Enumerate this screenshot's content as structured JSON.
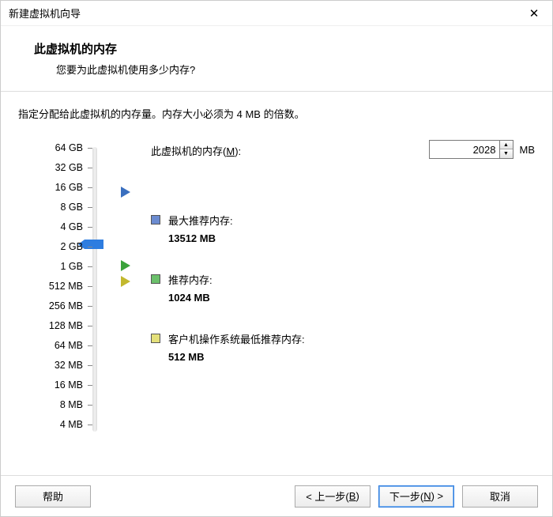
{
  "window": {
    "title": "新建虚拟机向导"
  },
  "header": {
    "heading": "此虚拟机的内存",
    "subtext": "您要为此虚拟机使用多少内存?"
  },
  "instruction": "指定分配给此虚拟机的内存量。内存大小必须为 4 MB 的倍数。",
  "memory": {
    "label_prefix": "此虚拟机的内存(",
    "label_accel": "M",
    "label_suffix": "):",
    "value": "2028",
    "unit": "MB",
    "ticks": [
      "64 GB",
      "32 GB",
      "16 GB",
      "8 GB",
      "4 GB",
      "2 GB",
      "1 GB",
      "512 MB",
      "256 MB",
      "128 MB",
      "64 MB",
      "32 MB",
      "16 MB",
      "8 MB",
      "4 MB"
    ]
  },
  "legends": {
    "max": {
      "label": "最大推荐内存:",
      "value": "13512 MB"
    },
    "rec": {
      "label": "推荐内存:",
      "value": "1024 MB"
    },
    "min": {
      "label": "客户机操作系统最低推荐内存:",
      "value": "512 MB"
    }
  },
  "buttons": {
    "help": "帮助",
    "back_prefix": "< 上一步(",
    "back_accel": "B",
    "back_suffix": ")",
    "next_prefix": "下一步(",
    "next_accel": "N",
    "next_suffix": ") >",
    "cancel": "取消"
  }
}
